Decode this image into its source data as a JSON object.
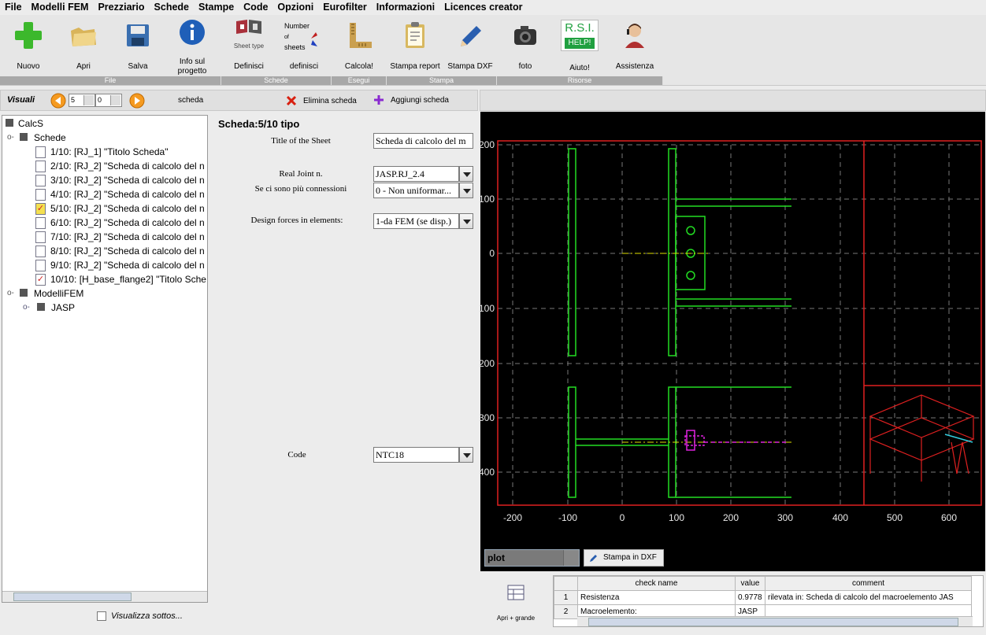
{
  "menu": [
    "File",
    "Modelli FEM",
    "Prezziario",
    "Schede",
    "Stampe",
    "Code",
    "Opzioni",
    "Eurofilter",
    "Informazioni",
    "Licences creator"
  ],
  "toolbar": {
    "nuovo": "Nuovo",
    "apri": "Apri",
    "salva": "Salva",
    "info1": "Info sul",
    "info2": "progetto",
    "sheet_type": "Sheet type",
    "definisci_upper": "Definisci",
    "num1": "Number",
    "num2": "of",
    "num3": "sheets",
    "definisci_lower": "definisci",
    "calcola": "Calcola!",
    "stampa_report": "Stampa report",
    "stampa_dxf": "Stampa DXF",
    "foto": "foto",
    "rsi": "R.S.I.",
    "help": "HELP!",
    "aiuto": "Aiuto!",
    "assistenza": "Assistenza",
    "groups": {
      "file": "File",
      "schede": "Schede",
      "esegui": "Esegui",
      "stampa": "Stampa",
      "risorse": "Risorse"
    }
  },
  "nav": {
    "visuali": "Visuali",
    "left_value": "5",
    "right_value": "0",
    "scheda": "scheda",
    "elimina": "Elimina scheda",
    "aggiungi": "Aggiungi scheda"
  },
  "tree": {
    "root": "CalcS",
    "schede": "Schede",
    "items": [
      "1/10: [RJ_1] \"Titolo Scheda\"",
      "2/10: [RJ_2] \"Scheda di calcolo del n",
      "3/10: [RJ_2] \"Scheda di calcolo del n",
      "4/10: [RJ_2] \"Scheda di calcolo del n",
      "5/10: [RJ_2] \"Scheda di calcolo del n",
      "6/10: [RJ_2] \"Scheda di calcolo del n",
      "7/10: [RJ_2] \"Scheda di calcolo del n",
      "8/10: [RJ_2] \"Scheda di calcolo del n",
      "9/10: [RJ_2] \"Scheda di calcolo del n",
      "10/10: [H_base_flange2] \"Titolo Sche"
    ],
    "modelli": "ModelliFEM",
    "jasp": "JASP",
    "visualizza": "Visualizza sottos..."
  },
  "form": {
    "heading": "Scheda:5/10 tipo",
    "title_label": "Title of the Sheet",
    "title_value": "Scheda di calcolo del m",
    "joint_label": "Real Joint n.",
    "joint_value": "JASP.RJ_2.4",
    "conn_label": "Se ci sono più connessioni",
    "conn_value": "0 - Non uniformar...",
    "forces_label": "Design forces in elements:",
    "forces_value": "1-da FEM (se disp.)",
    "code_label": "Code",
    "code_value": "NTC18"
  },
  "plot": {
    "x_ticks": [
      "-200",
      "-100",
      "0",
      "100",
      "200",
      "300",
      "400",
      "500",
      "600"
    ],
    "y_ticks": [
      "200",
      "100",
      "0",
      "100",
      "200",
      "300",
      "400"
    ],
    "selector": "plot",
    "stampa_dxf": "Stampa in DXF"
  },
  "grid": {
    "apri": "Apri + grande",
    "headers": [
      "check name",
      "value",
      "comment"
    ],
    "rows": [
      {
        "n": "1",
        "name": "Resistenza",
        "value": "0.9778",
        "comment": "rilevata in: Scheda di calcolo del macroelemento JAS"
      },
      {
        "n": "2",
        "name": "Macroelemento:",
        "value": "JASP",
        "comment": ""
      }
    ]
  },
  "colors": {
    "outline_red": "#e02020",
    "steel_green": "#22dd22",
    "bolt_magenta": "#dd22dd",
    "axis_yellow": "#e0e000"
  }
}
